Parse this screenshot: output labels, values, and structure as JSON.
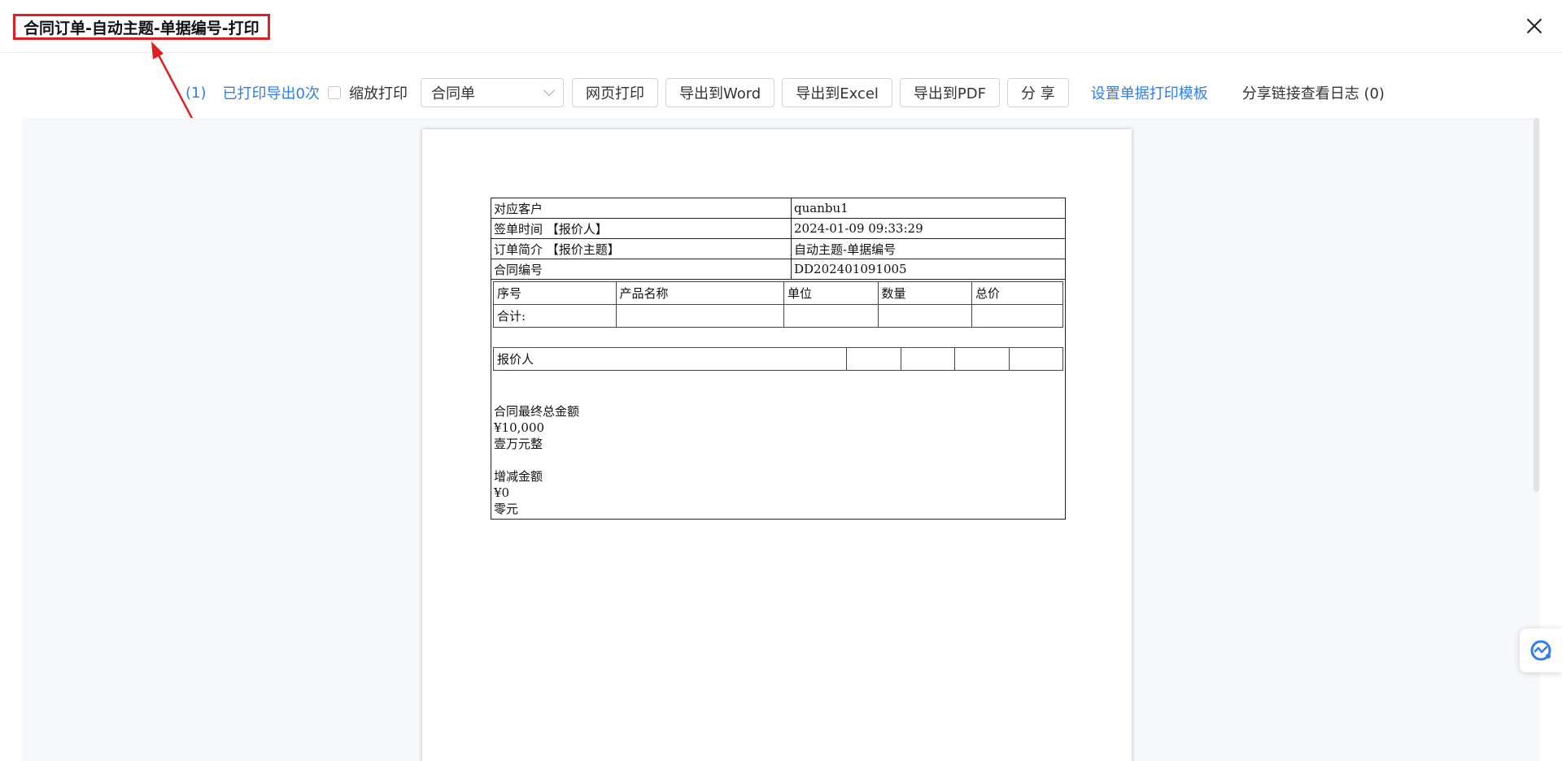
{
  "header": {
    "title": "合同订单-自动主题-单据编号-打印"
  },
  "toolbar": {
    "count": "(1)",
    "print_count": "已打印导出0次",
    "zoom_print_label": "缩放打印",
    "template_select": "合同单",
    "buttons": [
      "网页打印",
      "导出到Word",
      "导出到Excel",
      "导出到PDF",
      "分 享"
    ],
    "set_template": "设置单据打印模板",
    "share_log": "分享链接查看日志 (0)"
  },
  "document": {
    "info_rows": [
      {
        "label": "对应客户",
        "value": "quanbu1"
      },
      {
        "label": "签单时间 【报价人】",
        "value": "2024-01-09 09:33:29"
      },
      {
        "label": "订单简介 【报价主题】",
        "value": "自动主题-单据编号"
      },
      {
        "label": "合同编号",
        "value": "DD202401091005"
      }
    ],
    "product_headers": [
      "序号",
      "产品名称",
      "单位",
      "数量",
      "总价"
    ],
    "total_label": "合计:",
    "quoter_label": "报价人",
    "final_amount_label": "合同最终总金额",
    "final_amount": "¥10,000",
    "final_amount_upper": "壹万元整",
    "adjust_label": "增减金额",
    "adjust_amount": "¥0",
    "adjust_upper": "零元"
  },
  "colors": {
    "accent": "#2f7cf5",
    "annotation": "#e02020",
    "preview_bg": "#f6f8fb"
  },
  "icons": {
    "close": "close-icon",
    "float": "assistant-icon",
    "dropdown": "chevron-down-icon"
  }
}
